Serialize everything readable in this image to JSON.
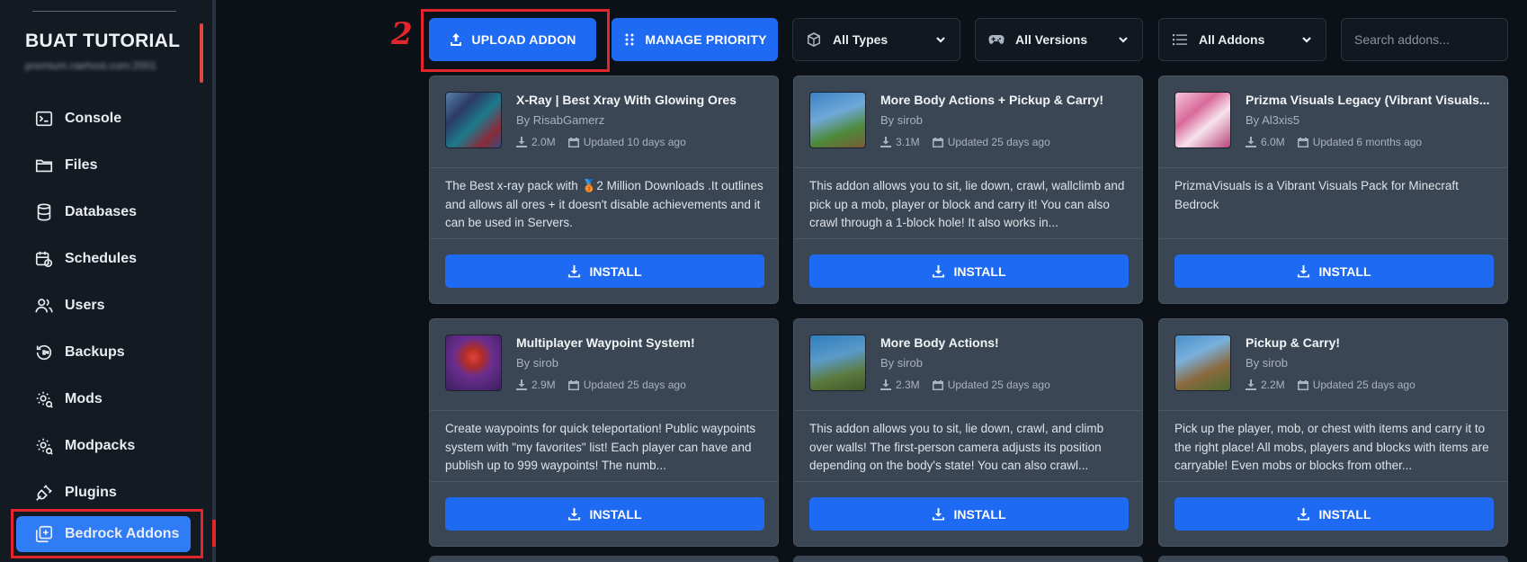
{
  "sidebar": {
    "brand": "BUAT TUTORIAL",
    "brand_sub": "premium.raehost.com:2001",
    "items": [
      {
        "label": "Console",
        "icon": "terminal-icon"
      },
      {
        "label": "Files",
        "icon": "folder-icon"
      },
      {
        "label": "Databases",
        "icon": "database-icon"
      },
      {
        "label": "Schedules",
        "icon": "calendar-clock-icon"
      },
      {
        "label": "Users",
        "icon": "users-icon"
      },
      {
        "label": "Backups",
        "icon": "backup-icon"
      },
      {
        "label": "Mods",
        "icon": "mods-gear-icon"
      },
      {
        "label": "Modpacks",
        "icon": "modpacks-gear-icon"
      },
      {
        "label": "Plugins",
        "icon": "plug-icon"
      },
      {
        "label": "Bedrock Addons",
        "icon": "addons-plus-icon",
        "active": true
      }
    ]
  },
  "annotation": {
    "step_number": "2"
  },
  "toolbar": {
    "upload_label": "UPLOAD ADDON",
    "priority_label": "MANAGE PRIORITY",
    "types_value": "All Types",
    "versions_value": "All Versions",
    "addons_value": "All Addons",
    "search_placeholder": "Search addons..."
  },
  "install_label": "INSTALL",
  "cards": [
    {
      "title": "X-Ray | Best Xray With Glowing Ores",
      "author": "By RisabGamerz",
      "downloads": "2.0M",
      "updated": "Updated 10 days ago",
      "description": "The Best x-ray pack with 🥉2 Million Downloads .It outlines and allows all ores + it doesn't disable achievements and it can be used in Servers."
    },
    {
      "title": "More Body Actions + Pickup & Carry!",
      "author": "By sirob",
      "downloads": "3.1M",
      "updated": "Updated 25 days ago",
      "description": "This addon allows you to sit, lie down, crawl, wallclimb and pick up a mob, player or block and carry it! You can also crawl through a 1-block hole! It also works in..."
    },
    {
      "title": "Prizma Visuals Legacy (Vibrant Visuals...",
      "author": "By Al3xis5",
      "downloads": "6.0M",
      "updated": "Updated 6 months ago",
      "description": "PrizmaVisuals is a Vibrant Visuals Pack for Minecraft Bedrock"
    },
    {
      "title": "Multiplayer Waypoint System!",
      "author": "By sirob",
      "downloads": "2.9M",
      "updated": "Updated 25 days ago",
      "description": "Create waypoints for quick teleportation! Public waypoints system with \"my favorites\" list! Each player can have and publish up to 999 waypoints! The numb..."
    },
    {
      "title": "More Body Actions!",
      "author": "By sirob",
      "downloads": "2.3M",
      "updated": "Updated 25 days ago",
      "description": "This addon allows you to sit, lie down, crawl, and climb over walls! The first-person camera adjusts its position depending on the body's state! You can also crawl..."
    },
    {
      "title": "Pickup & Carry!",
      "author": "By sirob",
      "downloads": "2.2M",
      "updated": "Updated 25 days ago",
      "description": "Pick up the player, mob, or chest with items and carry it to the right place! All mobs, players and blocks with items are carryable! Even mobs or blocks from other..."
    }
  ],
  "colors": {
    "accent_blue": "#1f6af2",
    "active_nav": "#2f7cf6",
    "annotation_red": "#e3262b",
    "card_bg": "#3b4654",
    "page_bg": "#0c1118"
  }
}
